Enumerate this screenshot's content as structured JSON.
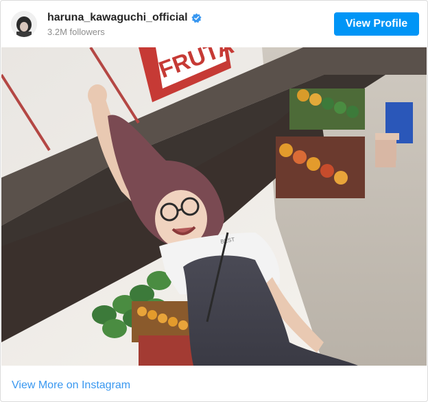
{
  "profile": {
    "username": "haruna_kawaguchi_official",
    "followers": "3.2M followers",
    "verified": true,
    "view_profile_label": "View Profile"
  },
  "post": {
    "sign_text": "FRUTA",
    "shirt_text": "BEST"
  },
  "footer": {
    "link_label": "View More on Instagram"
  },
  "colors": {
    "accent": "#0095f6",
    "link": "#3897f0",
    "text_primary": "#262626",
    "text_secondary": "#8e8e8e",
    "border": "#dbdbdb"
  },
  "icons": {
    "verified": "verified-badge-icon"
  }
}
